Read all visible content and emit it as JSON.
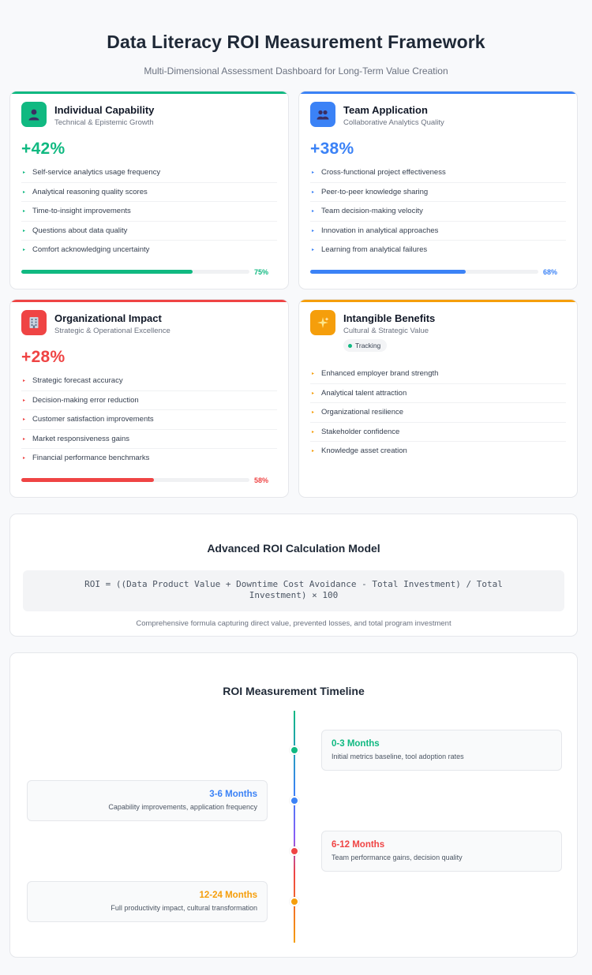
{
  "header": {
    "title": "Data Literacy ROI Measurement Framework",
    "subtitle": "Multi-Dimensional Assessment Dashboard for Long-Term Value Creation"
  },
  "cards": {
    "individual": {
      "icon": "person-icon",
      "title": "Individual Capability",
      "subtitle": "Technical & Epistemic Growth",
      "metric": "+42%",
      "accent": "#10b981",
      "items": [
        "Self-service analytics usage frequency",
        "Analytical reasoning quality scores",
        "Time-to-insight improvements",
        "Questions about data quality",
        "Comfort acknowledging uncertainty"
      ],
      "progress_label": "75%",
      "progress_value": 75
    },
    "team": {
      "icon": "people-icon",
      "title": "Team Application",
      "subtitle": "Collaborative Analytics Quality",
      "metric": "+38%",
      "accent": "#3b82f6",
      "items": [
        "Cross-functional project effectiveness",
        "Peer-to-peer knowledge sharing",
        "Team decision-making velocity",
        "Innovation in analytical approaches",
        "Learning from analytical failures"
      ],
      "progress_label": "68%",
      "progress_value": 68
    },
    "organizational": {
      "icon": "building-icon",
      "title": "Organizational Impact",
      "subtitle": "Strategic & Operational Excellence",
      "metric": "+28%",
      "accent": "#ef4444",
      "items": [
        "Strategic forecast accuracy",
        "Decision-making error reduction",
        "Customer satisfaction improvements",
        "Market responsiveness gains",
        "Financial performance benchmarks"
      ],
      "progress_label": "58%",
      "progress_value": 58
    },
    "intangible": {
      "icon": "sparkles-icon",
      "title": "Intangible Benefits",
      "subtitle": "Cultural & Strategic Value",
      "badge": "Tracking",
      "accent": "#f59e0b",
      "items": [
        "Enhanced employer brand strength",
        "Analytical talent attraction",
        "Organizational resilience",
        "Stakeholder confidence",
        "Knowledge asset creation"
      ]
    }
  },
  "formula": {
    "title": "Advanced ROI Calculation Model",
    "expression": "ROI = ((Data Product Value + Downtime Cost Avoidance - Total Investment) / Total Investment) × 100",
    "note": "Comprehensive formula capturing direct value, prevented losses, and total program investment"
  },
  "timeline": {
    "title": "ROI Measurement Timeline",
    "milestones": [
      {
        "period": "0-3 Months",
        "description": "Initial metrics baseline, tool adoption rates",
        "color": "#10b981"
      },
      {
        "period": "3-6 Months",
        "description": "Capability improvements, application frequency",
        "color": "#3b82f6"
      },
      {
        "period": "6-12 Months",
        "description": "Team performance gains, decision quality",
        "color": "#ef4444"
      },
      {
        "period": "12-24 Months",
        "description": "Full productivity impact, cultural transformation",
        "color": "#f59e0b"
      }
    ]
  }
}
